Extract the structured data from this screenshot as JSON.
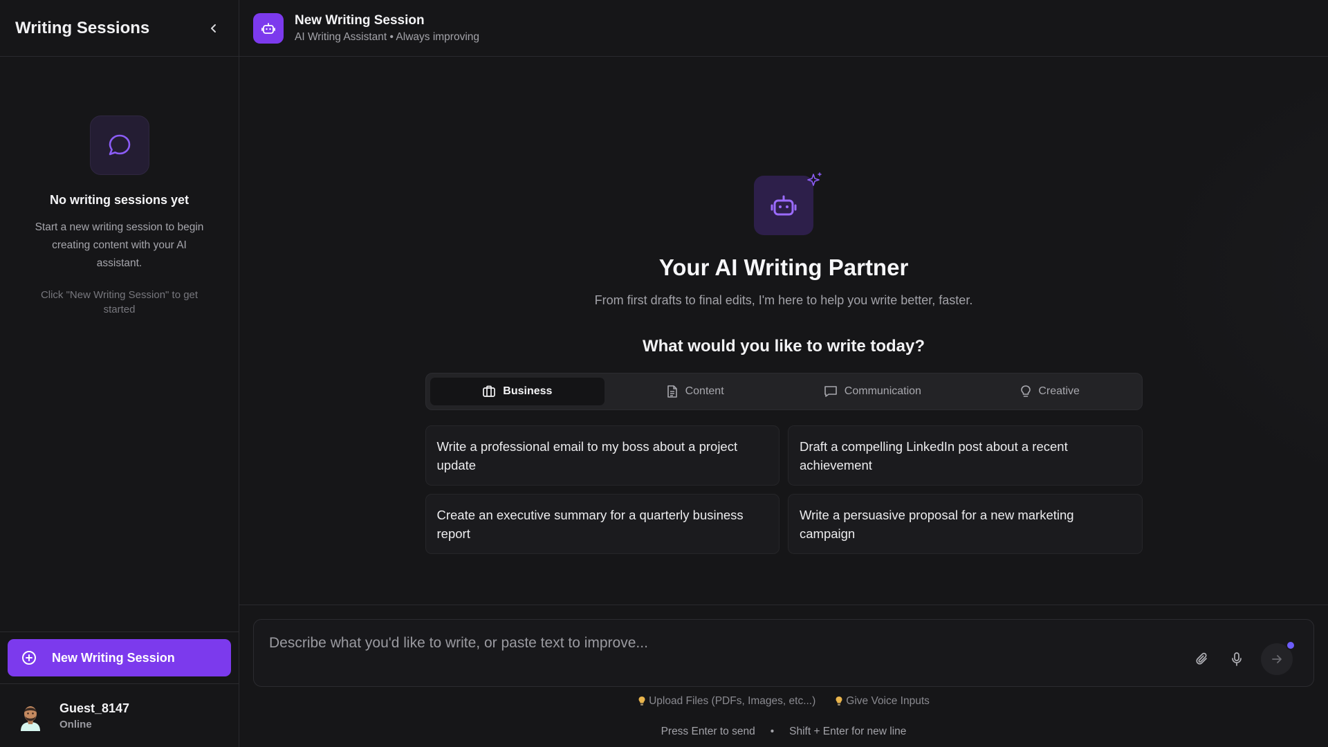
{
  "sidebar": {
    "title": "Writing Sessions",
    "empty": {
      "title": "No writing sessions yet",
      "description": "Start a new writing session to begin creating content with your AI assistant.",
      "hint": "Click \"New Writing Session\" to get started"
    },
    "new_session_label": "New Writing Session",
    "user": {
      "name": "Guest_8147",
      "status": "Online"
    }
  },
  "header": {
    "title": "New Writing Session",
    "subtitle": "AI Writing Assistant • Always improving"
  },
  "hero": {
    "title": "Your AI Writing Partner",
    "subtitle": "From first drafts to final edits, I'm here to help you write better, faster.",
    "question": "What would you like to write today?"
  },
  "tabs": [
    {
      "label": "Business",
      "icon": "briefcase-icon",
      "active": true
    },
    {
      "label": "Content",
      "icon": "document-icon",
      "active": false
    },
    {
      "label": "Communication",
      "icon": "chat-icon",
      "active": false
    },
    {
      "label": "Creative",
      "icon": "lightbulb-icon",
      "active": false
    }
  ],
  "prompts": [
    "Write a professional email to my boss about a project update",
    "Draft a compelling LinkedIn post about a recent achievement",
    "Create an executive summary for a quarterly business report",
    "Write a persuasive proposal for a new marketing campaign"
  ],
  "composer": {
    "placeholder": "Describe what you'd like to write, or paste text to improve...",
    "hints": [
      "Upload Files (PDFs, Images, etc...)",
      "Give Voice Inputs"
    ],
    "send_hint": "Press Enter to send",
    "separator": "•",
    "newline_hint": "Shift + Enter for new line"
  },
  "colors": {
    "accent": "#7c3aed",
    "background": "#161618",
    "border": "#2a2a2e"
  }
}
